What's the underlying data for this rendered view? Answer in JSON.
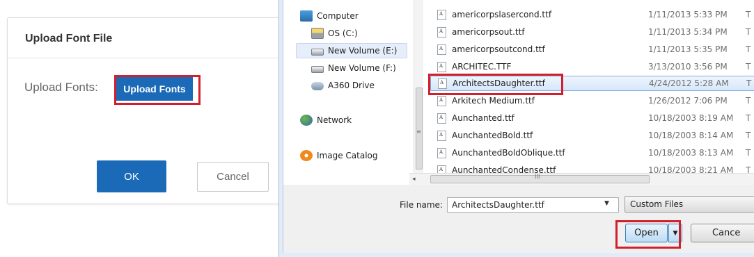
{
  "upload_dialog": {
    "title": "Upload Font File",
    "upload_label": "Upload Fonts:",
    "upload_button": "Upload Fonts",
    "ok_button": "OK",
    "cancel_button": "Cancel"
  },
  "file_dialog": {
    "nav_items": [
      {
        "label": "Computer",
        "icon": "computer-icon"
      },
      {
        "label": "OS (C:)",
        "icon": "drive-icon"
      },
      {
        "label": "New Volume (E:)",
        "icon": "drive-icon",
        "selected": true
      },
      {
        "label": "New Volume (F:)",
        "icon": "drive-icon"
      },
      {
        "label": "A360 Drive",
        "icon": "cloud-drive-icon"
      },
      {
        "label": "Network",
        "icon": "network-icon"
      },
      {
        "label": "Image Catalog",
        "icon": "image-catalog-icon"
      }
    ],
    "files": [
      {
        "name": "americorpslasercond.ttf",
        "date": "1/11/2013 5:33 PM",
        "type": "T"
      },
      {
        "name": "americorpsout.ttf",
        "date": "1/11/2013 5:34 PM",
        "type": "T"
      },
      {
        "name": "americorpsoutcond.ttf",
        "date": "1/11/2013 5:35 PM",
        "type": "T"
      },
      {
        "name": "ARCHITEC.TTF",
        "date": "3/13/2010 3:56 PM",
        "type": "T"
      },
      {
        "name": "ArchitectsDaughter.ttf",
        "date": "4/24/2012 5:28 AM",
        "type": "T",
        "selected": true
      },
      {
        "name": "Arkitech Medium.ttf",
        "date": "1/26/2012 7:06 PM",
        "type": "T"
      },
      {
        "name": "Aunchanted.ttf",
        "date": "10/18/2003 8:19 AM",
        "type": "T"
      },
      {
        "name": "AunchantedBold.ttf",
        "date": "10/18/2003 8:14 AM",
        "type": "T"
      },
      {
        "name": "AunchantedBoldOblique.ttf",
        "date": "10/18/2003 8:13 AM",
        "type": "T"
      },
      {
        "name": "AunchantedCondense.ttf",
        "date": "10/18/2003 8:21 AM",
        "type": "T"
      }
    ],
    "scroll_grip": "≡",
    "hscroll_grip": "III",
    "file_name_label": "File name:",
    "file_name_value": "ArchitectsDaughter.ttf",
    "file_type_filter": "Custom Files",
    "open_button": "Open",
    "cancel_button": "Cance"
  },
  "highlight_color": "#d21f2b",
  "accent_color": "#1a6ab8"
}
